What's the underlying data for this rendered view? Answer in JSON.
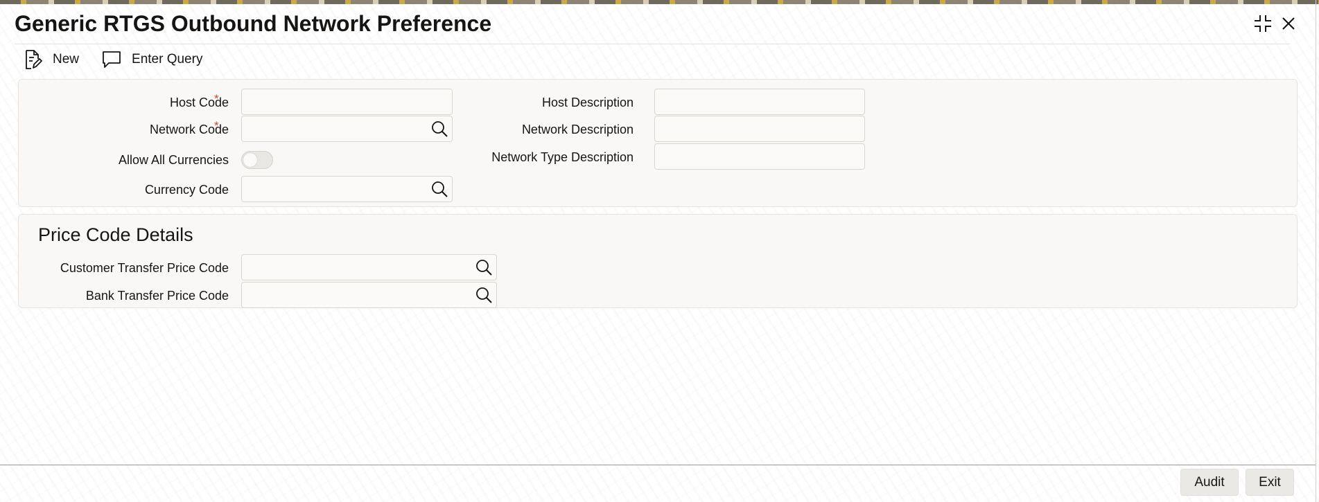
{
  "window": {
    "title": "Generic RTGS Outbound Network Preference",
    "minimize_icon": "collapse-icon",
    "close_icon": "close-icon"
  },
  "toolbar": {
    "new_label": "New",
    "new_icon": "new-document-icon",
    "enter_query_label": "Enter Query",
    "enter_query_icon": "speech-bubble-icon"
  },
  "main_form": {
    "host_code": {
      "label": "Host Code",
      "required_mark": "*",
      "value": ""
    },
    "network_code": {
      "label": "Network Code",
      "required_mark": "*",
      "value": "",
      "lookup_icon": "search-icon"
    },
    "allow_all_currencies": {
      "label": "Allow All Currencies",
      "checked": false
    },
    "currency_code": {
      "label": "Currency Code",
      "value": "",
      "lookup_icon": "search-icon"
    },
    "host_description": {
      "label": "Host Description",
      "value": ""
    },
    "network_description": {
      "label": "Network Description",
      "value": ""
    },
    "network_type_description": {
      "label": "Network Type Description",
      "value": ""
    }
  },
  "price_code_details": {
    "title": "Price Code Details",
    "customer_transfer_price_code": {
      "label": "Customer Transfer Price Code",
      "value": "",
      "lookup_icon": "search-icon"
    },
    "bank_transfer_price_code": {
      "label": "Bank Transfer Price Code",
      "value": "",
      "lookup_icon": "search-icon"
    }
  },
  "footer": {
    "audit_label": "Audit",
    "exit_label": "Exit"
  },
  "colors": {
    "required_mark": "#c74634",
    "panel_background": "#f9f8f7",
    "button_background": "#ebe9e5",
    "text": "#161513"
  }
}
